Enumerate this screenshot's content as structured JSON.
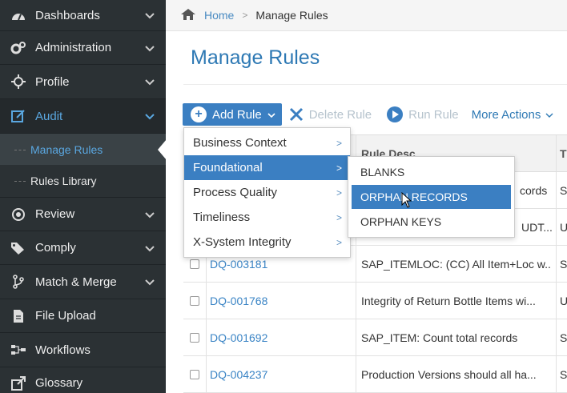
{
  "sidebar": {
    "items": [
      {
        "label": "Dashboards",
        "icon": "dashboard-icon"
      },
      {
        "label": "Administration",
        "icon": "gears-icon"
      },
      {
        "label": "Profile",
        "icon": "crosshair-icon"
      },
      {
        "label": "Audit",
        "icon": "edit-icon"
      },
      {
        "label": "Review",
        "icon": "target-icon"
      },
      {
        "label": "Comply",
        "icon": "tags-icon"
      },
      {
        "label": "Match & Merge",
        "icon": "merge-icon"
      },
      {
        "label": "File Upload",
        "icon": "file-icon"
      },
      {
        "label": "Workflows",
        "icon": "workflow-icon"
      },
      {
        "label": "Glossary",
        "icon": "external-link-icon"
      }
    ],
    "audit_sub": [
      {
        "label": "Manage Rules"
      },
      {
        "label": "Rules Library"
      }
    ]
  },
  "breadcrumb": {
    "home": "Home",
    "current": "Manage Rules"
  },
  "page": {
    "title": "Manage Rules"
  },
  "toolbar": {
    "add_rule": "Add Rule",
    "delete_rule": "Delete Rule",
    "run_rule": "Run Rule",
    "more_actions": "More Actions"
  },
  "table": {
    "headers": {
      "rule_desc": "Rule Desc",
      "type_initial": "T"
    },
    "rows": [
      {
        "id": "",
        "desc": "cords",
        "type": "S"
      },
      {
        "id": "",
        "desc": "UDT...",
        "type": "U"
      },
      {
        "id": "DQ-003181",
        "desc": "SAP_ITEMLOC: (CC) All Item+Loc w...",
        "type": "S"
      },
      {
        "id": "DQ-001768",
        "desc": "Integrity of Return Bottle Items wi...",
        "type": "U"
      },
      {
        "id": "DQ-001692",
        "desc": "SAP_ITEM: Count total records",
        "type": "S"
      },
      {
        "id": "DQ-004237",
        "desc": "Production Versions should all ha...",
        "type": "S"
      }
    ]
  },
  "add_menu": {
    "items": [
      "Business Context",
      "Foundational",
      "Process Quality",
      "Timeliness",
      "X-System Integrity"
    ],
    "highlighted": "Foundational"
  },
  "foundational_menu": {
    "items": [
      "BLANKS",
      "ORPHAN RECORDS",
      "ORPHAN KEYS"
    ],
    "highlighted": "ORPHAN RECORDS"
  },
  "colors": {
    "accent": "#3b7fc2",
    "sidebar": "#2b3134",
    "link": "#2e79b4"
  }
}
